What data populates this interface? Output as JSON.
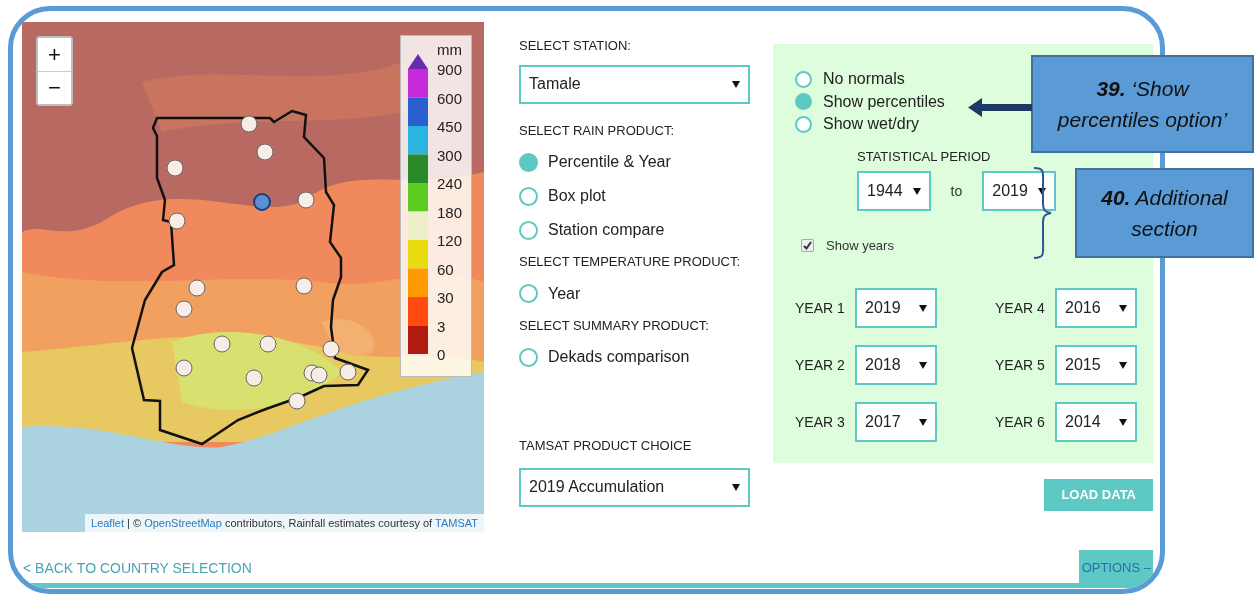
{
  "map": {
    "zoom_in": "+",
    "zoom_out": "−",
    "legend": {
      "unit": "mm",
      "labels": [
        "900",
        "600",
        "450",
        "300",
        "240",
        "180",
        "120",
        "60",
        "30",
        "3",
        "0"
      ],
      "bands": [
        {
          "color": "#6a2ab0"
        },
        {
          "color": "#c42ad8"
        },
        {
          "color": "#2a5fd0"
        },
        {
          "color": "#2ab4e0"
        },
        {
          "color": "#2a8a2a"
        },
        {
          "color": "#5ccc22"
        },
        {
          "color": "#eeeec8"
        },
        {
          "color": "#e8dc10"
        },
        {
          "color": "#ff9a00"
        },
        {
          "color": "#ff4a10"
        },
        {
          "color": "#b01a10"
        }
      ]
    },
    "markers": [
      {
        "selected": false
      },
      {
        "selected": false
      },
      {
        "selected": false
      },
      {
        "selected": true
      },
      {
        "selected": false
      },
      {
        "selected": false
      },
      {
        "selected": false
      },
      {
        "selected": false
      },
      {
        "selected": false
      },
      {
        "selected": false
      },
      {
        "selected": false
      },
      {
        "selected": false
      },
      {
        "selected": false
      },
      {
        "selected": false
      },
      {
        "selected": false
      },
      {
        "selected": false
      },
      {
        "selected": false
      },
      {
        "selected": false
      }
    ],
    "attribution": [
      {
        "text": "Leaflet",
        "kind": "link"
      },
      {
        "text": " | © ",
        "kind": "text"
      },
      {
        "text": "OpenStreetMap",
        "kind": "link"
      },
      {
        "text": " contributors, Rainfall estimates courtesy of ",
        "kind": "text"
      },
      {
        "text": "TAMSAT",
        "kind": "link"
      }
    ]
  },
  "station": {
    "label": "SELECT STATION:",
    "value": "Tamale"
  },
  "product_groups": [
    {
      "label": "SELECT RAIN PRODUCT:",
      "options": [
        {
          "label": "Percentile & Year",
          "selected": true
        },
        {
          "label": "Box plot",
          "selected": false
        },
        {
          "label": "Station compare",
          "selected": false
        }
      ]
    },
    {
      "label": "SELECT TEMPERATURE PRODUCT:",
      "options": [
        {
          "label": "Year",
          "selected": false
        }
      ]
    },
    {
      "label": "SELECT SUMMARY PRODUCT:",
      "options": [
        {
          "label": "Dekads comparison",
          "selected": false
        }
      ]
    }
  ],
  "tamsat": {
    "label": "TAMSAT PRODUCT CHOICE",
    "value": "2019 Accumulation"
  },
  "normals": [
    {
      "label": "No normals",
      "selected": false
    },
    {
      "label": "Show percentiles",
      "selected": true
    },
    {
      "label": "Show wet/dry",
      "selected": false
    }
  ],
  "statistical_period": {
    "label": "STATISTICAL PERIOD",
    "from": "1944",
    "to_label": "to",
    "to": "2019"
  },
  "show_years": {
    "label": "Show years",
    "checked": true
  },
  "years": [
    {
      "label": "YEAR 1",
      "value": "2019"
    },
    {
      "label": "YEAR 2",
      "value": "2018"
    },
    {
      "label": "YEAR 3",
      "value": "2017"
    },
    {
      "label": "YEAR 4",
      "value": "2016"
    },
    {
      "label": "YEAR 5",
      "value": "2015"
    },
    {
      "label": "YEAR 6",
      "value": "2014"
    }
  ],
  "load_button": "LOAD DATA",
  "back_link": "< BACK TO COUNTRY SELECTION",
  "options_button": "OPTIONS –",
  "callouts": [
    {
      "text": "**39.** ‘Show percentiles option’"
    },
    {
      "text": "**40.** Additional section"
    }
  ]
}
